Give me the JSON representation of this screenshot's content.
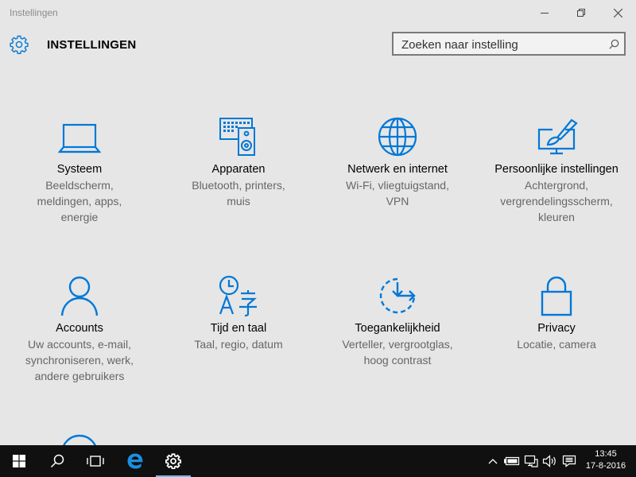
{
  "window": {
    "title": "Instellingen",
    "buttons": [
      "minimize-icon",
      "restore-icon",
      "close-icon"
    ]
  },
  "header": {
    "icon": "settings-gear-icon",
    "title": "INSTELLINGEN"
  },
  "search": {
    "placeholder": "Zoeken naar instelling",
    "icon": "search-icon"
  },
  "accent_color": "#0078d7",
  "categories": [
    {
      "icon": "laptop-icon",
      "name": "Systeem",
      "description": "Beeldscherm,\nmeldingen, apps,\nenergie"
    },
    {
      "icon": "devices-icon",
      "name": "Apparaten",
      "description": "Bluetooth, printers,\nmuis"
    },
    {
      "icon": "globe-icon",
      "name": "Netwerk en internet",
      "description": "Wi-Fi, vliegtuigstand,\nVPN"
    },
    {
      "icon": "personalization-icon",
      "name": "Persoonlijke instellingen",
      "description": "Achtergrond,\nvergrendelingsscherm,\nkleuren"
    },
    {
      "icon": "person-icon",
      "name": "Accounts",
      "description": "Uw accounts, e-mail,\nsynchroniseren, werk,\nandere gebruikers"
    },
    {
      "icon": "time-language-icon",
      "name": "Tijd en taal",
      "description": "Taal, regio, datum"
    },
    {
      "icon": "ease-of-access-icon",
      "name": "Toegankelijkheid",
      "description": "Verteller, vergrootglas,\nhoog contrast"
    },
    {
      "icon": "lock-icon",
      "name": "Privacy",
      "description": "Locatie, camera"
    }
  ],
  "taskbar": {
    "buttons": [
      "windows-start-icon",
      "search-icon",
      "task-view-icon",
      "edge-icon",
      "settings-gear-icon"
    ],
    "active": "settings-gear-icon",
    "tray_icons": [
      "chevron-up-icon",
      "battery-icon",
      "network-icon",
      "volume-icon",
      "action-center-icon"
    ],
    "time": "13:45",
    "date": "17-8-2016"
  }
}
